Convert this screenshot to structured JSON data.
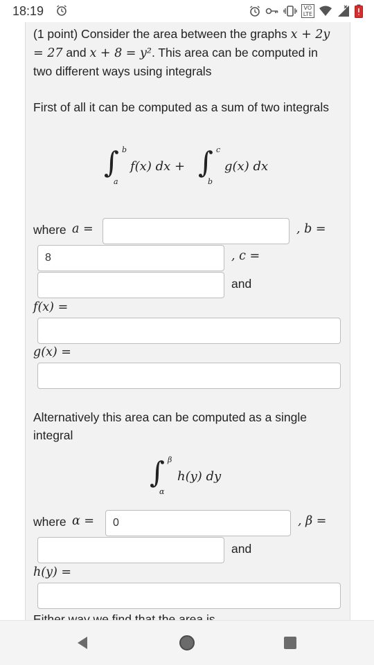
{
  "status_bar": {
    "time": "18:19",
    "lte_top": "VO",
    "lte_bottom": "LTE",
    "icons": [
      "alarm-icon",
      "alarm-icon",
      "key-icon",
      "vibrate-icon",
      "volte-icon",
      "wifi-icon",
      "signal-icon",
      "battery-icon"
    ]
  },
  "problem": {
    "intro_prefix": "(1 point) Consider the area between the graphs",
    "eq1": "x + 2y = 27",
    "and_word": "and",
    "eq2": "x + 8 = y²",
    "intro_suffix": ". This area can be computed in two different ways using integrals",
    "part1_text": "First of all it can be computed as a sum of two integrals",
    "formula1": {
      "lower1": "a",
      "upper1": "b",
      "integrand1": "f(x) dx +",
      "lower2": "b",
      "upper2": "c",
      "integrand2": "g(x) dx"
    },
    "where_a_label": "where",
    "var_a": "a =",
    "var_b": ", b =",
    "b_value": "8",
    "var_c": ", c =",
    "and_label": "and",
    "fx_label": "f(x) =",
    "gx_label": "g(x) =",
    "part2_text": "Alternatively this area can be computed as a single integral",
    "formula2": {
      "lower": "α",
      "upper": "β",
      "integrand": "h(y) dy"
    },
    "where_alpha_label": "where",
    "var_alpha": "α =",
    "alpha_value": "0",
    "var_beta": ", β =",
    "and_label2": "and",
    "hy_label": "h(y) =",
    "final_text": "Either way we find that the area is"
  },
  "accent_colors": {
    "panel_bg": "#f2f2f2",
    "input_border": "#bdbdbd",
    "nav_icon": "#6b6b6b"
  }
}
